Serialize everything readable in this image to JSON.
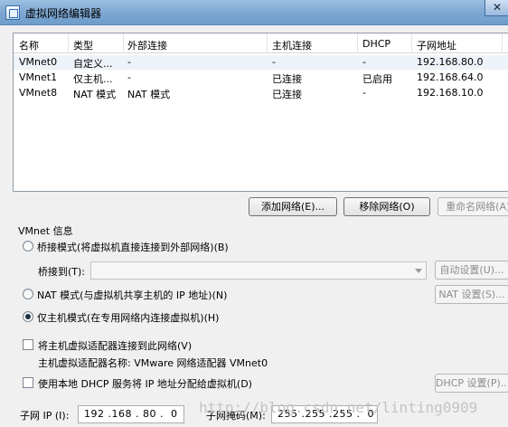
{
  "window": {
    "title": "虚拟网络编辑器",
    "close_glyph": "✕"
  },
  "table": {
    "headers": [
      "名称",
      "类型",
      "外部连接",
      "主机连接",
      "DHCP",
      "子网地址"
    ],
    "rows": [
      [
        "VMnet0",
        "自定义...",
        "-",
        "-",
        "-",
        "192.168.80.0"
      ],
      [
        "VMnet1",
        "仅主机...",
        "-",
        "已连接",
        "已启用",
        "192.168.64.0"
      ],
      [
        "VMnet8",
        "NAT 模式",
        "NAT 模式",
        "已连接",
        "-",
        "192.168.10.0"
      ]
    ]
  },
  "buttons": {
    "add_network": "添加网络(E)...",
    "remove_network": "移除网络(O)",
    "rename_network": "重命名网络(A)...",
    "auto_settings": "自动设置(U)...",
    "nat_settings": "NAT 设置(S)...",
    "dhcp_settings": "DHCP 设置(P)..."
  },
  "vmnet_info": {
    "section_label": "VMnet 信息",
    "bridged_label": "桥接模式(将虚拟机直接连接到外部网络)(B)",
    "bridged_to_label": "桥接到(T):",
    "bridged_to_value": "",
    "nat_label": "NAT 模式(与虚拟机共享主机的 IP 地址)(N)",
    "host_only_label": "仅主机模式(在专用网络内连接虚拟机)(H)",
    "selected_mode": "host_only",
    "connect_adapter_label": "将主机虚拟适配器连接到此网络(V)",
    "adapter_name_label": "主机虚拟适配器名称: VMware 网络适配器 VMnet0",
    "use_dhcp_label": "使用本地 DHCP 服务将 IP 地址分配给虚拟机(D)",
    "subnet_ip_label": "子网 IP (I):",
    "subnet_ip_value": "192 .168 . 80 .  0",
    "subnet_mask_label": "子网掩码(M):",
    "subnet_mask_value": "255 .255 .255 .  0"
  },
  "watermark": "http://blog.csdn.net/linting0909"
}
